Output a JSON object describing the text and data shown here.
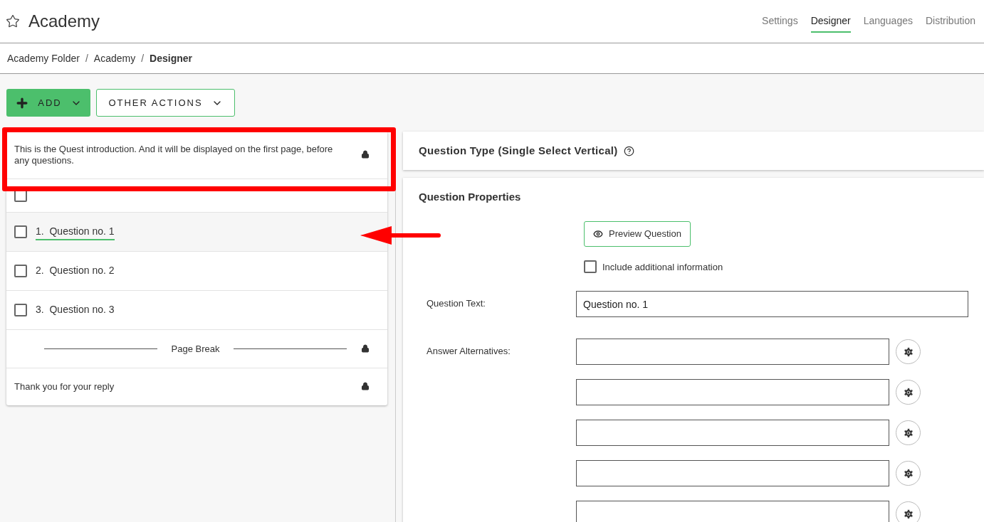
{
  "header": {
    "title": "Academy"
  },
  "nav_tabs": [
    {
      "label": "Settings",
      "selected": false
    },
    {
      "label": "Designer",
      "selected": true
    },
    {
      "label": "Languages",
      "selected": false
    },
    {
      "label": "Distribution",
      "selected": false
    }
  ],
  "breadcrumb": [
    {
      "label": "Academy Folder",
      "current": false
    },
    {
      "label": "Academy",
      "current": false
    },
    {
      "label": "Designer",
      "current": true
    }
  ],
  "breadcrumb_separator": "/",
  "toolbar": {
    "add": "ADD",
    "other": "OTHER ACTIONS"
  },
  "items": [
    {
      "kind": "intro",
      "text": "This is the Quest introduction. And it will be displayed on the first page, before any questions.",
      "locked": true
    },
    {
      "kind": "blank",
      "checked": false
    },
    {
      "kind": "question",
      "number": "1.",
      "text": "Question no. 1",
      "checked": false,
      "selected": true
    },
    {
      "kind": "question",
      "number": "2.",
      "text": "Question no. 2",
      "checked": false,
      "selected": false
    },
    {
      "kind": "question",
      "number": "3.",
      "text": "Question no. 3",
      "checked": false,
      "selected": false
    },
    {
      "kind": "pagebreak",
      "text": "Page Break",
      "locked": true
    },
    {
      "kind": "closing",
      "text": "Thank you for your reply",
      "locked": true
    }
  ],
  "question_type": {
    "title": "Question Type (Single Select Vertical)"
  },
  "properties": {
    "title": "Question Properties",
    "preview": "Preview Question",
    "include_info": {
      "label": "Include additional information",
      "checked": false
    },
    "question_text_label": "Question Text:",
    "question_text": "Question no. 1",
    "answers_label": "Answer Alternatives:",
    "answers": [
      {
        "kind": "field"
      },
      {
        "kind": "field"
      },
      {
        "kind": "field"
      },
      {
        "kind": "field"
      },
      {
        "kind": "field"
      }
    ]
  }
}
